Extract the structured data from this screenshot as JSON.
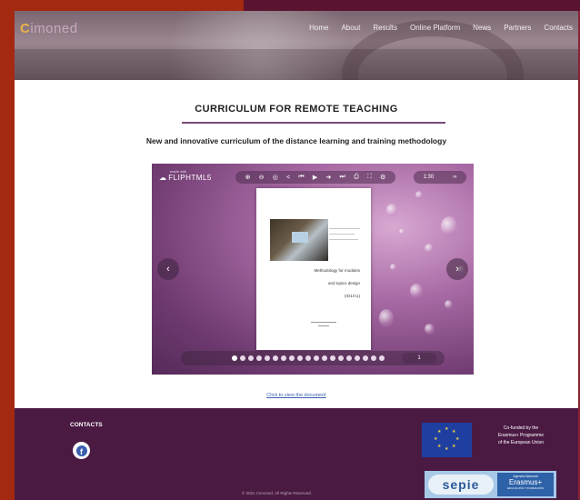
{
  "header": {
    "logo": "Cimoned",
    "nav": [
      "Home",
      "About",
      "Results",
      "Online Platform",
      "News",
      "Partners",
      "Contacts"
    ]
  },
  "main": {
    "title": "CURRICULUM FOR REMOTE TEACHING",
    "subtitle": "New and innovative curriculum of the distance learning and training methodology",
    "doc_link": "Click to view the document"
  },
  "viewer": {
    "brand_small": "made with",
    "brand": "FLIPHTML5",
    "zoom_label": "1:30",
    "page_counter": "1",
    "page_lines": [
      "Methodology for modules",
      "and topics design",
      "(IO1/A1)"
    ],
    "toolbar_icons": [
      "zoom-in-icon",
      "zoom-out-icon",
      "zoom-fit-icon",
      "share-icon",
      "first-page-icon",
      "play-icon",
      "next-icon",
      "last-page-icon",
      "print-icon",
      "fullscreen-icon",
      "settings-icon"
    ]
  },
  "footer": {
    "contacts": "CONTACTS",
    "eu_text": [
      "Co-funded by the",
      "Erasmus+ Programme",
      "of the European Union"
    ],
    "sepie": "sepie",
    "sepie_top": "Agencia Nacional",
    "sepie_mid": "Erasmus+",
    "sepie_bot": "EDUCACIÓN Y FORMACIÓN",
    "copyright": "© 2021 Cimoned. All Rights Reserved."
  },
  "colors": {
    "frame": "#a32a10",
    "footer": "#4b1a43",
    "accent_rule": "#7a4a78"
  }
}
